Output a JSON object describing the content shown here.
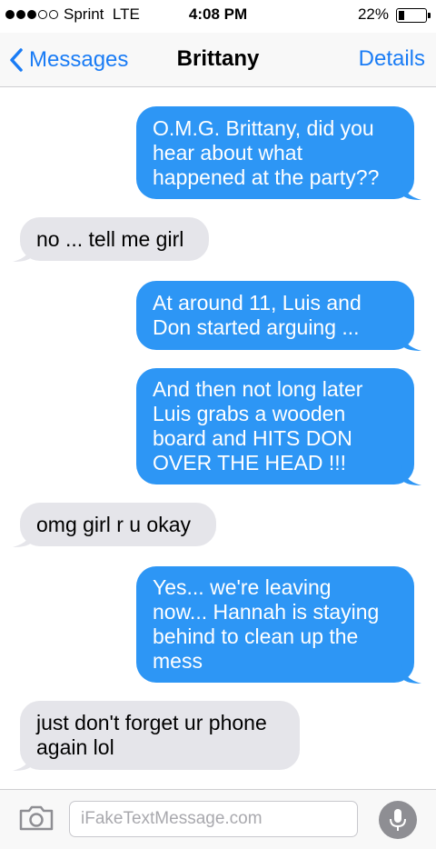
{
  "status_bar": {
    "signal_dots": [
      true,
      true,
      true,
      false,
      false
    ],
    "carrier": "Sprint",
    "network": "LTE",
    "time": "4:08 PM",
    "battery_percent": "22%",
    "battery_level": 0.22
  },
  "nav": {
    "back_label": "Messages",
    "title": "Brittany",
    "details_label": "Details"
  },
  "colors": {
    "accent": "#1a7cf5",
    "sent_bubble": "#2d96f5",
    "received_bubble": "#e5e5ea"
  },
  "messages": [
    {
      "direction": "sent",
      "lines": [
        "O.M.G. Brittany, did you",
        "hear about what",
        "happened at the party??"
      ]
    },
    {
      "direction": "received",
      "lines": [
        "no ... tell me girl"
      ]
    },
    {
      "direction": "sent",
      "lines": [
        "At around 11, Luis and",
        "Don started arguing ..."
      ]
    },
    {
      "direction": "sent",
      "lines": [
        "And then not long later",
        "Luis grabs a wooden",
        "board and HITS DON",
        "OVER THE HEAD !!!"
      ]
    },
    {
      "direction": "received",
      "lines": [
        "omg girl r u okay"
      ]
    },
    {
      "direction": "sent",
      "lines": [
        "Yes... we're leaving",
        "now... Hannah is staying",
        "behind to clean up the",
        "mess"
      ]
    },
    {
      "direction": "received",
      "lines": [
        "just don't forget ur phone",
        "again lol"
      ]
    }
  ],
  "input": {
    "placeholder": "iFakeTextMessage.com",
    "value": ""
  },
  "icons": {
    "back": "chevron-left-icon",
    "camera": "camera-icon",
    "mic": "microphone-icon"
  }
}
